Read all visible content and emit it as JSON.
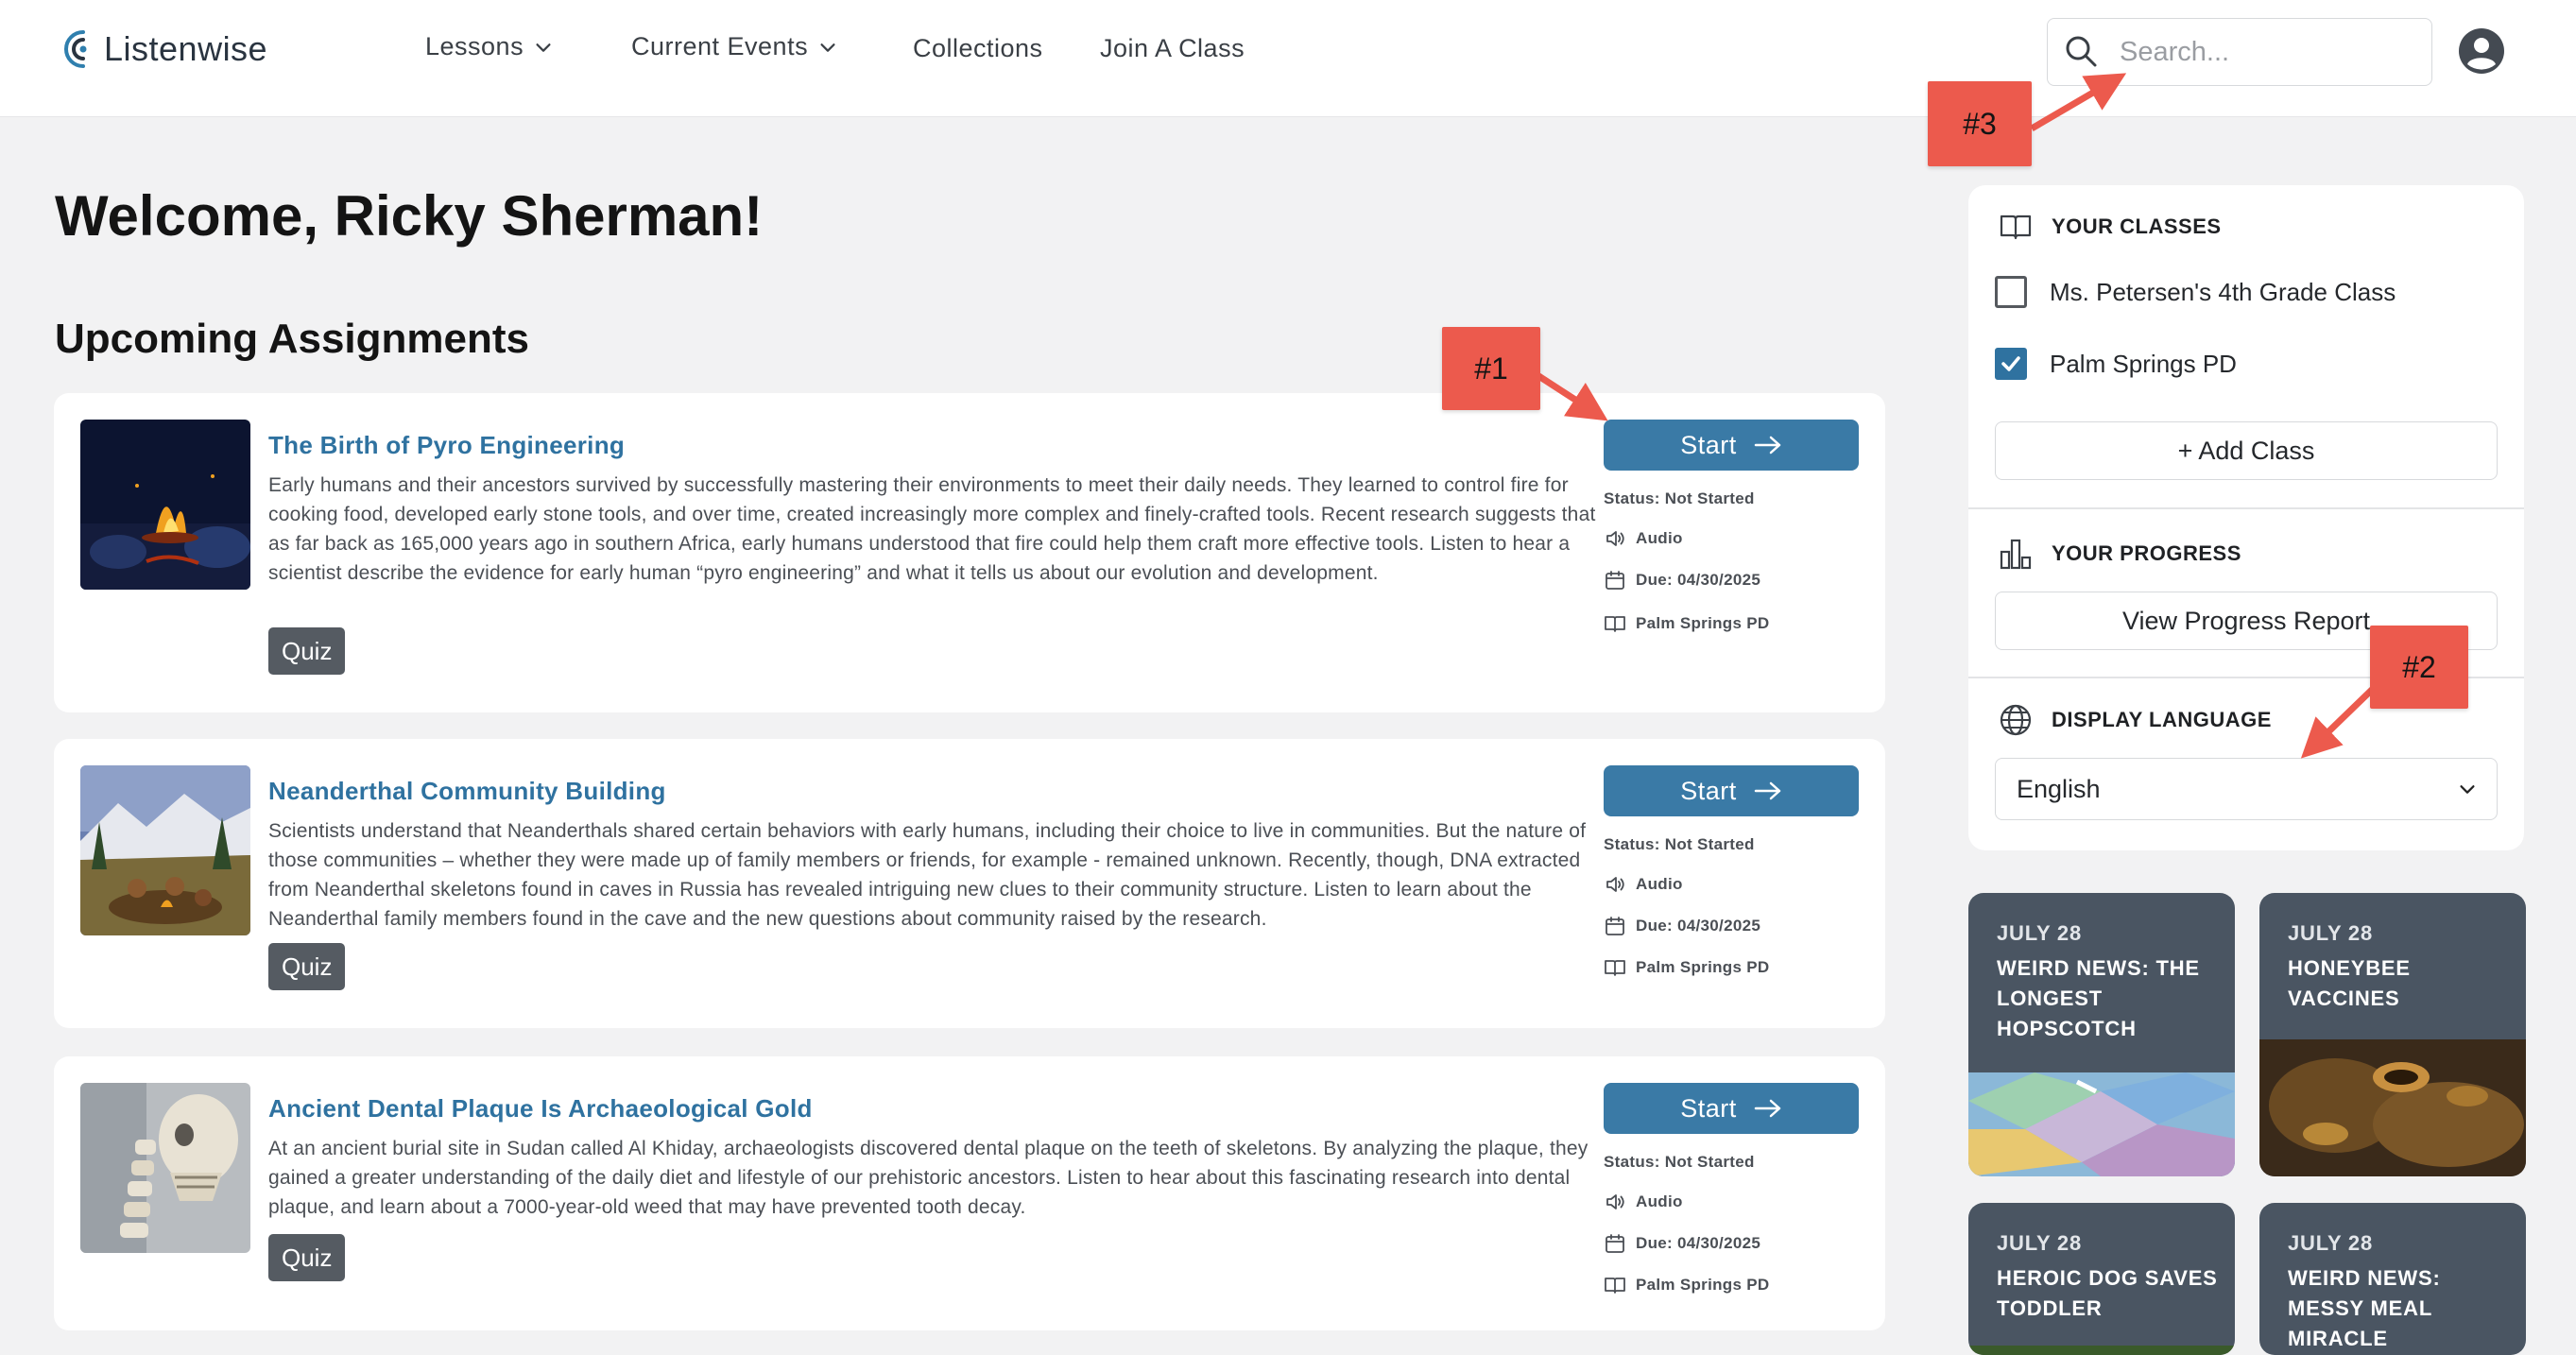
{
  "header": {
    "logo_text": "Listenwise",
    "nav": [
      {
        "label": "Lessons",
        "has_dropdown": true
      },
      {
        "label": "Current Events",
        "has_dropdown": true
      },
      {
        "label": "Collections",
        "has_dropdown": false
      },
      {
        "label": "Join A Class",
        "has_dropdown": false
      }
    ],
    "search_placeholder": "Search..."
  },
  "main": {
    "welcome": "Welcome, Ricky Sherman!",
    "section_title": "Upcoming Assignments",
    "assignments": [
      {
        "title": "The Birth of Pyro Engineering",
        "description": "Early humans and their ancestors survived by successfully mastering their environments to meet their daily needs. They learned to control fire for cooking food, developed early stone tools, and over time, created increasingly more complex and finely-crafted tools. Recent research suggests that as far back as 165,000 years ago in southern Africa, early humans understood that fire could help them craft more effective tools. Listen to hear a scientist describe the evidence for early human “pyro engineering” and what it tells us about our evolution and development.",
        "quiz_label": "Quiz",
        "start_label": "Start",
        "status": "Status:  Not Started",
        "media": "Audio",
        "due": "Due: 04/30/2025",
        "class": "Palm Springs PD"
      },
      {
        "title": "Neanderthal Community Building",
        "description": "Scientists understand that Neanderthals shared certain behaviors with early humans, including their choice to live in communities. But the nature of those communities – whether they were made up of family members or friends, for example - remained unknown. Recently, though, DNA extracted from Neanderthal skeletons found in caves in Russia has revealed intriguing new clues to their community structure. Listen to learn about the Neanderthal family members found in the cave and the new questions about community raised by the research.",
        "quiz_label": "Quiz",
        "start_label": "Start",
        "status": "Status:  Not Started",
        "media": "Audio",
        "due": "Due: 04/30/2025",
        "class": "Palm Springs PD"
      },
      {
        "title": "Ancient Dental Plaque Is Archaeological Gold",
        "description": "At an ancient burial site in Sudan called Al Khiday, archaeologists discovered dental plaque on the teeth of skeletons. By analyzing the plaque, they gained a greater understanding of the daily diet and lifestyle of our prehistoric ancestors. Listen to hear about this fascinating research into dental plaque, and learn about a 7000-year-old weed that may have prevented tooth decay.",
        "quiz_label": "Quiz",
        "start_label": "Start",
        "status": "Status:  Not Started",
        "media": "Audio",
        "due": "Due: 04/30/2025",
        "class": "Palm Springs PD"
      }
    ]
  },
  "sidebar": {
    "classes_heading": "YOUR CLASSES",
    "classes": [
      {
        "name": "Ms. Petersen's 4th Grade Class",
        "checked": false
      },
      {
        "name": "Palm Springs PD",
        "checked": true
      }
    ],
    "add_class_label": "+ Add Class",
    "progress_heading": "YOUR PROGRESS",
    "progress_button": "View Progress Report",
    "language_heading": "DISPLAY LANGUAGE",
    "language_value": "English",
    "news": [
      {
        "date": "JULY 28",
        "title": "WEIRD NEWS: THE LONGEST HOPSCOTCH"
      },
      {
        "date": "JULY 28",
        "title": "HONEYBEE VACCINES"
      },
      {
        "date": "JULY 28",
        "title": "HEROIC DOG SAVES TODDLER"
      },
      {
        "date": "JULY 28",
        "title": "WEIRD NEWS: MESSY MEAL MIRACLE"
      }
    ]
  },
  "annotations": [
    "#1",
    "#2",
    "#3"
  ],
  "colors": {
    "accent": "#3a7aa6",
    "link": "#2f72a0",
    "annotation": "#ec5a4d",
    "news_card": "#4a5562"
  }
}
